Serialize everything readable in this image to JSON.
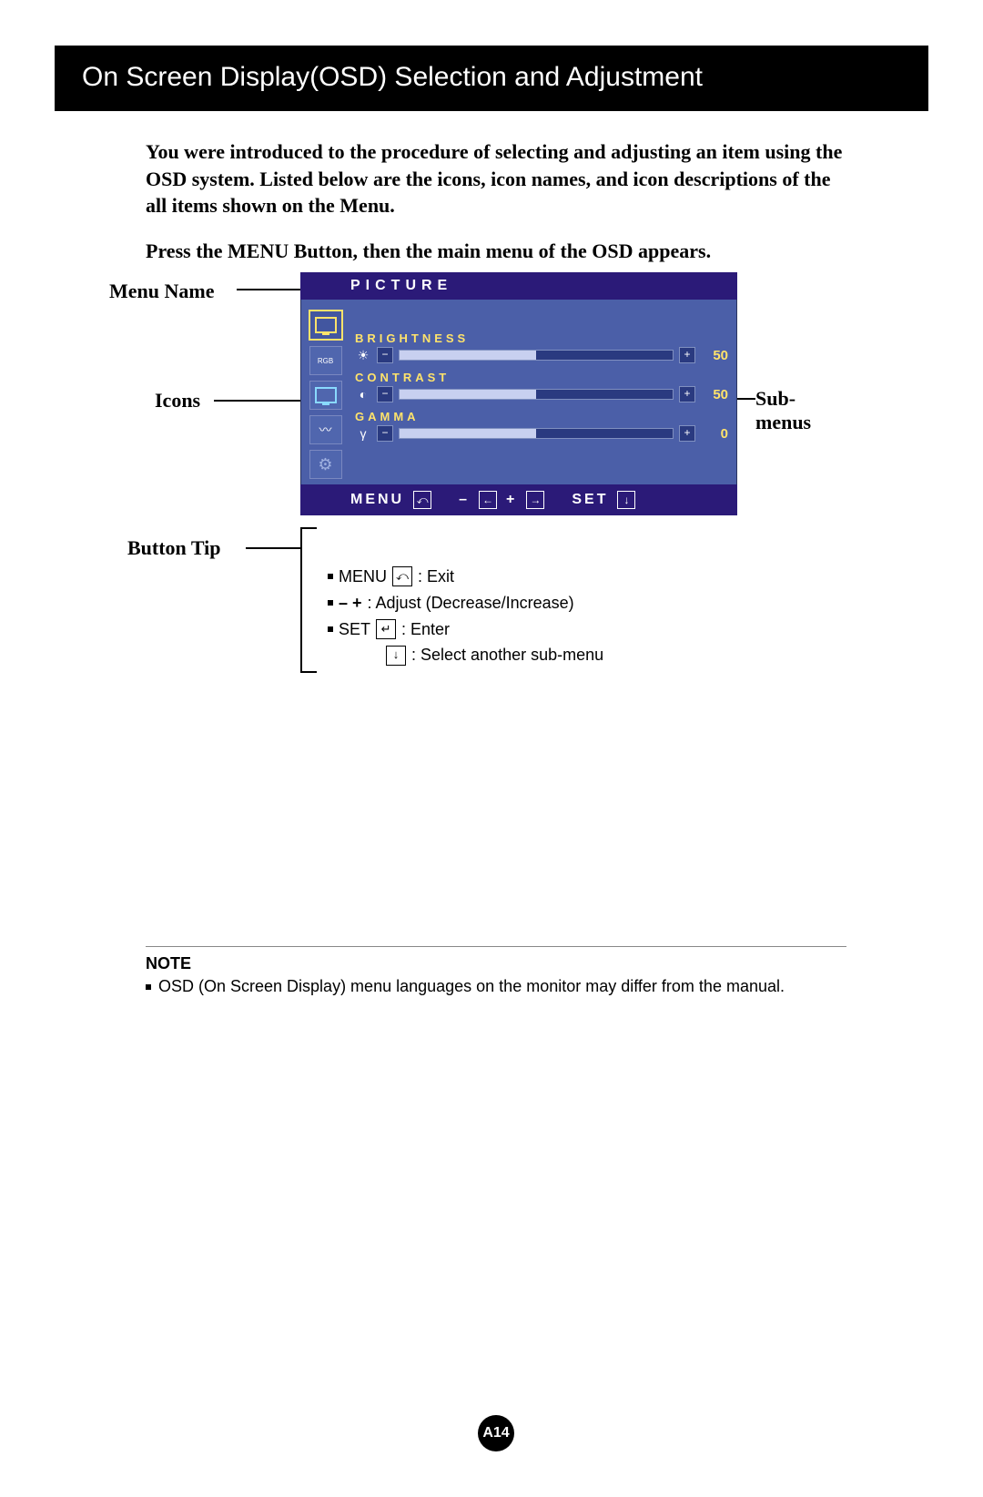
{
  "title": "On Screen Display(OSD) Selection and Adjustment",
  "intro": "You were introduced to the procedure of selecting and adjusting an item using the OSD system.  Listed below are the icons, icon names, and icon descriptions of the all items shown on the Menu.",
  "instruction": "Press the MENU Button, then the main menu of the OSD appears.",
  "labels": {
    "menu_name": "Menu Name",
    "icons": "Icons",
    "sub_menus": "Sub-menus",
    "button_tip": "Button Tip"
  },
  "osd": {
    "title": "PICTURE",
    "subs": [
      {
        "label": "BRIGHTNESS",
        "icon": "☀",
        "value": "50",
        "fill": 50
      },
      {
        "label": "CONTRAST",
        "icon": "◐",
        "value": "50",
        "fill": 50
      },
      {
        "label": "GAMMA",
        "icon": "γ",
        "value": "0",
        "fill": 50
      }
    ],
    "footer": {
      "menu": "MENU",
      "minus": "–",
      "plus": "+",
      "set": "SET"
    }
  },
  "tips": [
    {
      "key": "MENU",
      "icon": "⤺",
      "desc": ": Exit"
    },
    {
      "key": "–   +",
      "icon": "",
      "desc": ": Adjust (Decrease/Increase)"
    },
    {
      "key": "SET",
      "icon": "↵",
      "desc": ": Enter"
    },
    {
      "key": "",
      "icon": "↓",
      "desc": ": Select another sub-menu"
    }
  ],
  "note": {
    "title": "NOTE",
    "text": "OSD (On Screen Display) menu languages on the monitor may differ from the manual."
  },
  "page_number": "A14"
}
